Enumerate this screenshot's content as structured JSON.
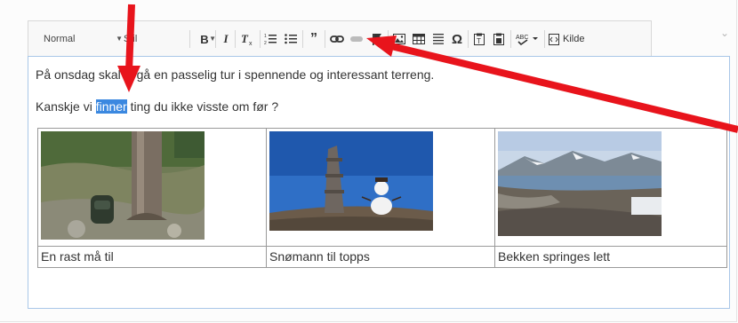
{
  "toolbar": {
    "format_value": "Normal",
    "style_placeholder": "Stil",
    "source_label": "Kilde",
    "buttons": [
      "bold-icon",
      "italic-icon",
      "remove-format-icon",
      "numbered-list-icon",
      "bulleted-list-icon",
      "blockquote-icon",
      "link-icon",
      "unlink-icon",
      "anchor-icon",
      "image-icon",
      "table-icon",
      "horizontal-line-icon",
      "special-char-icon",
      "paste-text-icon",
      "paste-word-icon",
      "spellcheck-icon",
      "source-icon"
    ]
  },
  "editor": {
    "paragraph1": "På onsdag skal vi gå en passelig tur i spennende og interessant terreng.",
    "paragraph2_before": "Kanskje vi ",
    "paragraph2_selected": "finner",
    "paragraph2_after": " ting du ikke visste om før ?",
    "table": {
      "captions": [
        "En rast må til",
        "Snømann til topps",
        "Bekken springes lett"
      ]
    }
  },
  "colors": {
    "selection": "#3b88e0",
    "annotation_arrow": "#e8141c",
    "editor_border": "#a9c7e8"
  }
}
